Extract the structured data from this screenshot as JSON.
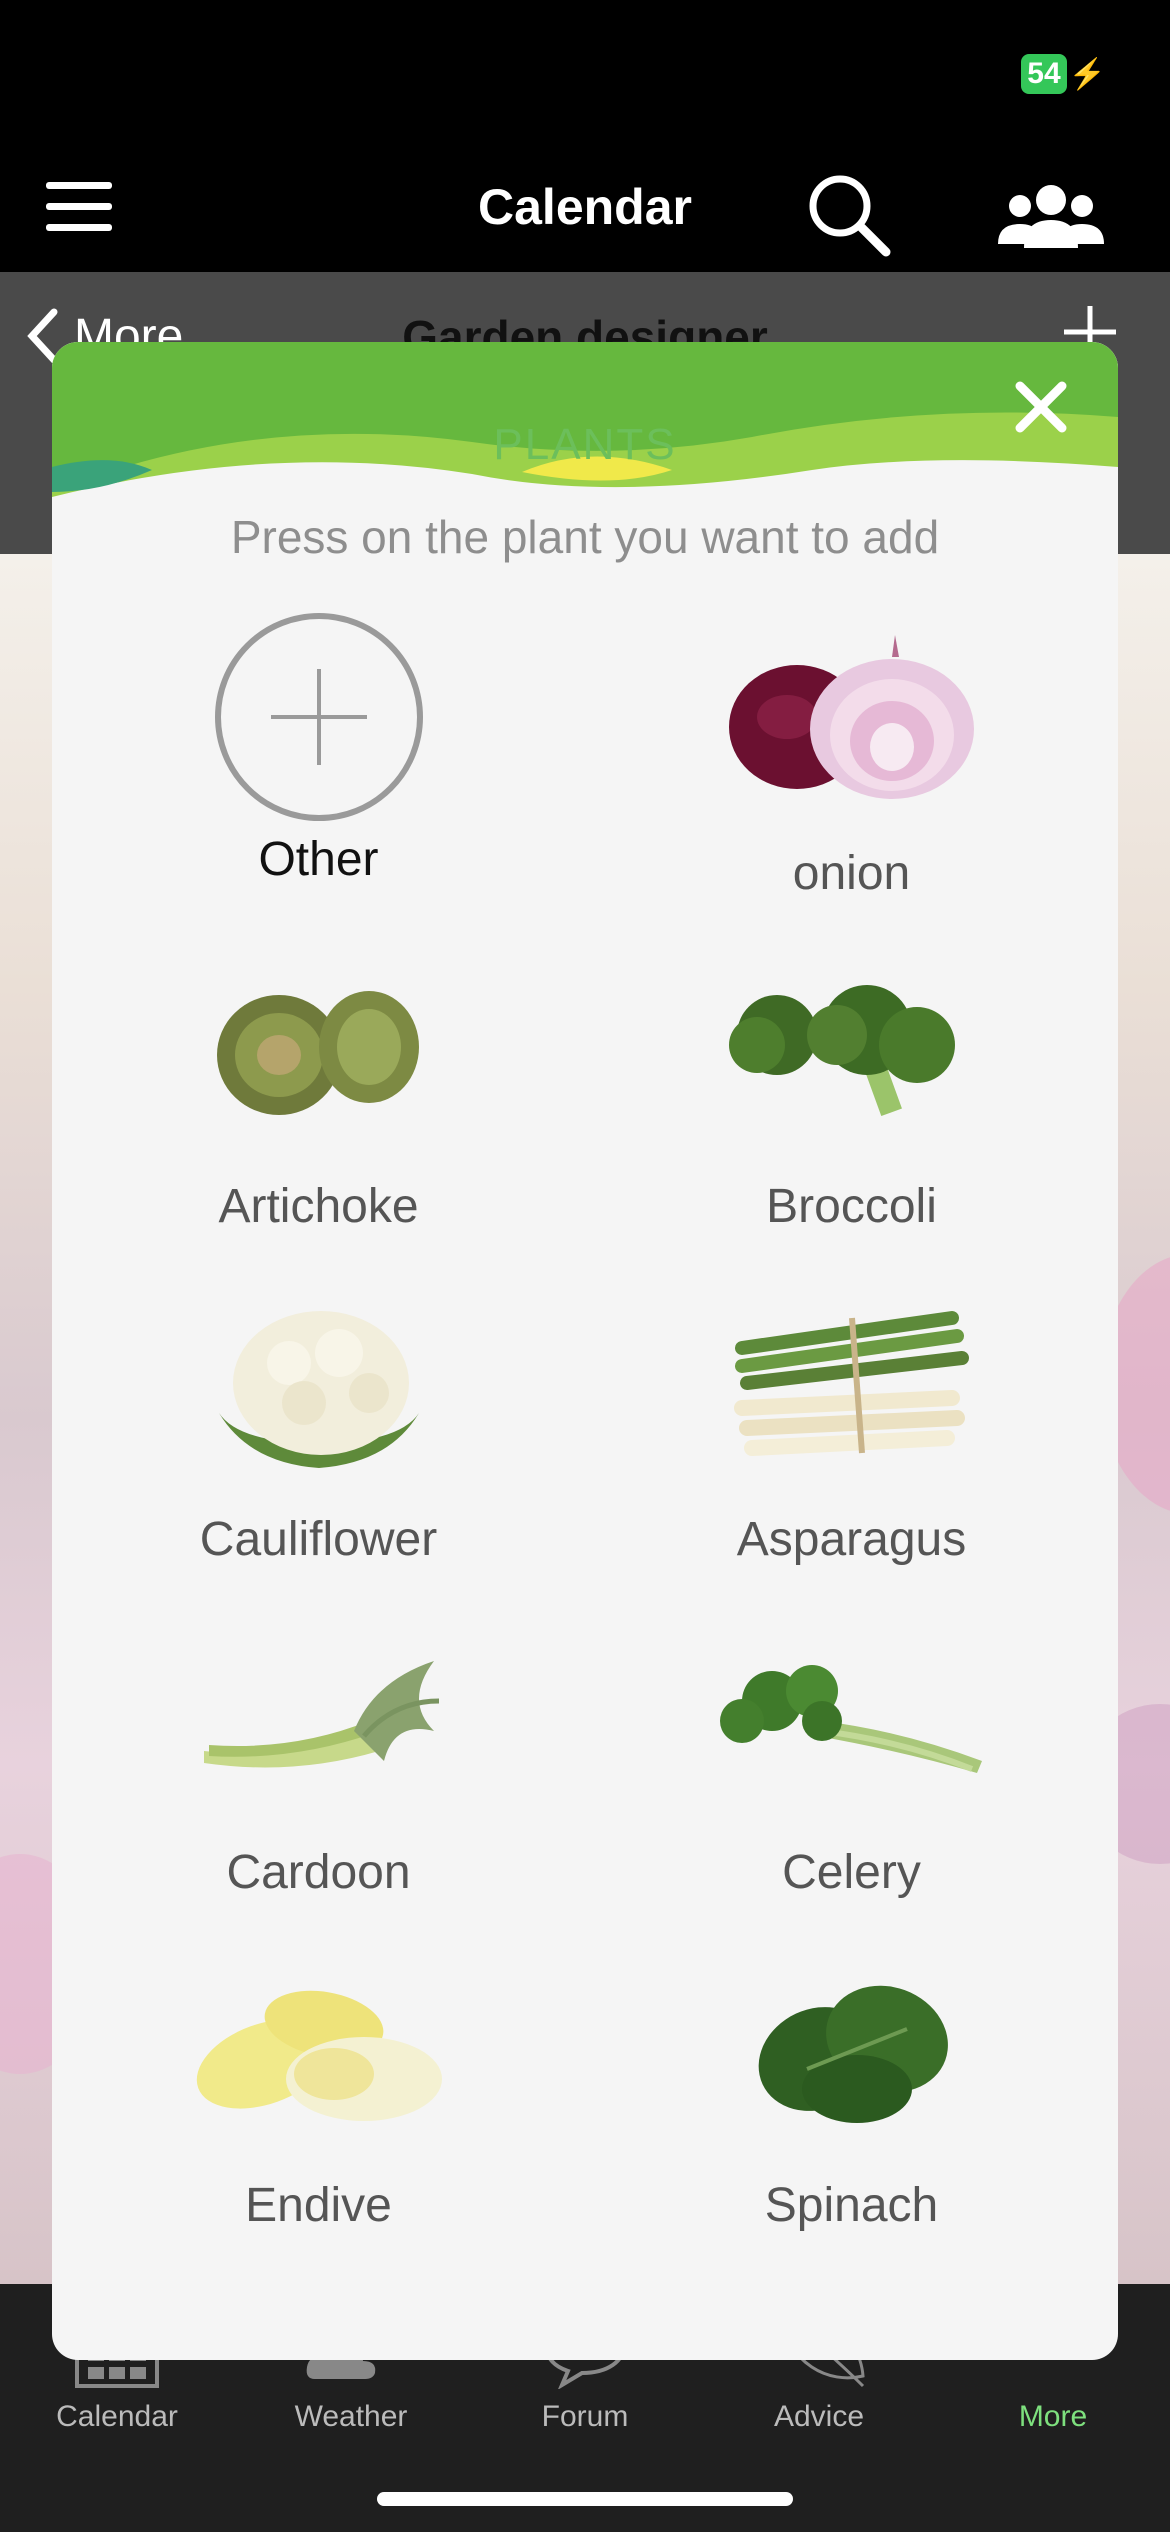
{
  "status": {
    "battery": "54"
  },
  "navbar": {
    "title": "Calendar"
  },
  "subbar": {
    "back_label": "More",
    "title": "Garden designer"
  },
  "modal": {
    "title": "PLANTS",
    "subtitle": "Press on the plant you want to add",
    "plants": [
      {
        "label": "Other",
        "icon": "add-circle-icon"
      },
      {
        "label": "onion",
        "icon": "onion-icon"
      },
      {
        "label": "Artichoke",
        "icon": "artichoke-icon"
      },
      {
        "label": "Broccoli",
        "icon": "broccoli-icon"
      },
      {
        "label": "Cauliflower",
        "icon": "cauliflower-icon"
      },
      {
        "label": "Asparagus",
        "icon": "asparagus-icon"
      },
      {
        "label": "Cardoon",
        "icon": "cardoon-icon"
      },
      {
        "label": "Celery",
        "icon": "celery-icon"
      },
      {
        "label": "Endive",
        "icon": "endive-icon"
      },
      {
        "label": "Spinach",
        "icon": "spinach-icon"
      }
    ]
  },
  "tabbar": {
    "tabs": [
      {
        "label": "Calendar",
        "icon": "calendar-grid-icon"
      },
      {
        "label": "Weather",
        "icon": "weather-icon"
      },
      {
        "label": "Forum",
        "icon": "forum-bubble-icon"
      },
      {
        "label": "Advice",
        "icon": "leaf-icon"
      },
      {
        "label": "More",
        "icon": "more-dots-icon"
      }
    ],
    "active_color": "#7ee07e"
  },
  "colors": {
    "header_green": "#5fb53c",
    "modal_bg": "#f5f5f5",
    "title_green": "#6cbf5b"
  }
}
